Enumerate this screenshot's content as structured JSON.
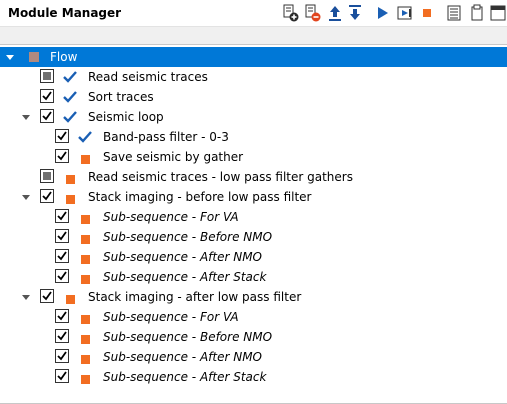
{
  "panel": {
    "title": "Module Manager"
  },
  "toolbar": {
    "buttons": [
      {
        "name": "add-module-icon"
      },
      {
        "name": "remove-module-icon"
      },
      {
        "name": "move-up-icon"
      },
      {
        "name": "move-down-icon"
      },
      {
        "name": "run-icon"
      },
      {
        "name": "run-step-icon"
      },
      {
        "name": "stop-icon"
      },
      {
        "name": "list-icon"
      },
      {
        "name": "clipboard-icon"
      },
      {
        "name": "window-icon"
      }
    ]
  },
  "tree": {
    "root": {
      "label": "Flow",
      "selected": true,
      "expanded": true
    },
    "items": [
      {
        "label": "Read seismic traces",
        "check": "partial",
        "status": "done",
        "italic": false,
        "depth": 1
      },
      {
        "label": "Sort traces",
        "check": "checked",
        "status": "done",
        "italic": false,
        "depth": 1
      },
      {
        "label": "Seismic loop",
        "check": "checked",
        "status": "done",
        "italic": false,
        "depth": 1,
        "expanded": true
      },
      {
        "label": "Band-pass filter - 0-3",
        "check": "checked",
        "status": "done",
        "italic": false,
        "depth": 2
      },
      {
        "label": "Save seismic by gather",
        "check": "checked",
        "status": "pending",
        "italic": false,
        "depth": 2
      },
      {
        "label": "Read seismic traces - low pass filter gathers",
        "check": "partial",
        "status": "pending",
        "italic": false,
        "depth": 1
      },
      {
        "label": "Stack imaging - before low pass filter",
        "check": "checked",
        "status": "pending",
        "italic": false,
        "depth": 1,
        "expanded": true
      },
      {
        "label": "Sub-sequence - For VA",
        "check": "checked",
        "status": "pending",
        "italic": true,
        "depth": 2
      },
      {
        "label": "Sub-sequence - Before NMO",
        "check": "checked",
        "status": "pending",
        "italic": true,
        "depth": 2
      },
      {
        "label": "Sub-sequence - After NMO",
        "check": "checked",
        "status": "pending",
        "italic": true,
        "depth": 2
      },
      {
        "label": "Sub-sequence - After Stack",
        "check": "checked",
        "status": "pending",
        "italic": true,
        "depth": 2
      },
      {
        "label": "Stack imaging - after low pass filter",
        "check": "checked",
        "status": "pending",
        "italic": false,
        "depth": 1,
        "expanded": true
      },
      {
        "label": "Sub-sequence - For VA",
        "check": "checked",
        "status": "pending",
        "italic": true,
        "depth": 2
      },
      {
        "label": "Sub-sequence - Before NMO",
        "check": "checked",
        "status": "pending",
        "italic": true,
        "depth": 2
      },
      {
        "label": "Sub-sequence - After NMO",
        "check": "checked",
        "status": "pending",
        "italic": true,
        "depth": 2
      },
      {
        "label": "Sub-sequence - After Stack",
        "check": "checked",
        "status": "pending",
        "italic": true,
        "depth": 2
      }
    ]
  },
  "colors": {
    "selection": "#0078d7",
    "status_done": "#1a5fb4",
    "status_pending": "#f26d21",
    "root_square": "#b08a80"
  }
}
